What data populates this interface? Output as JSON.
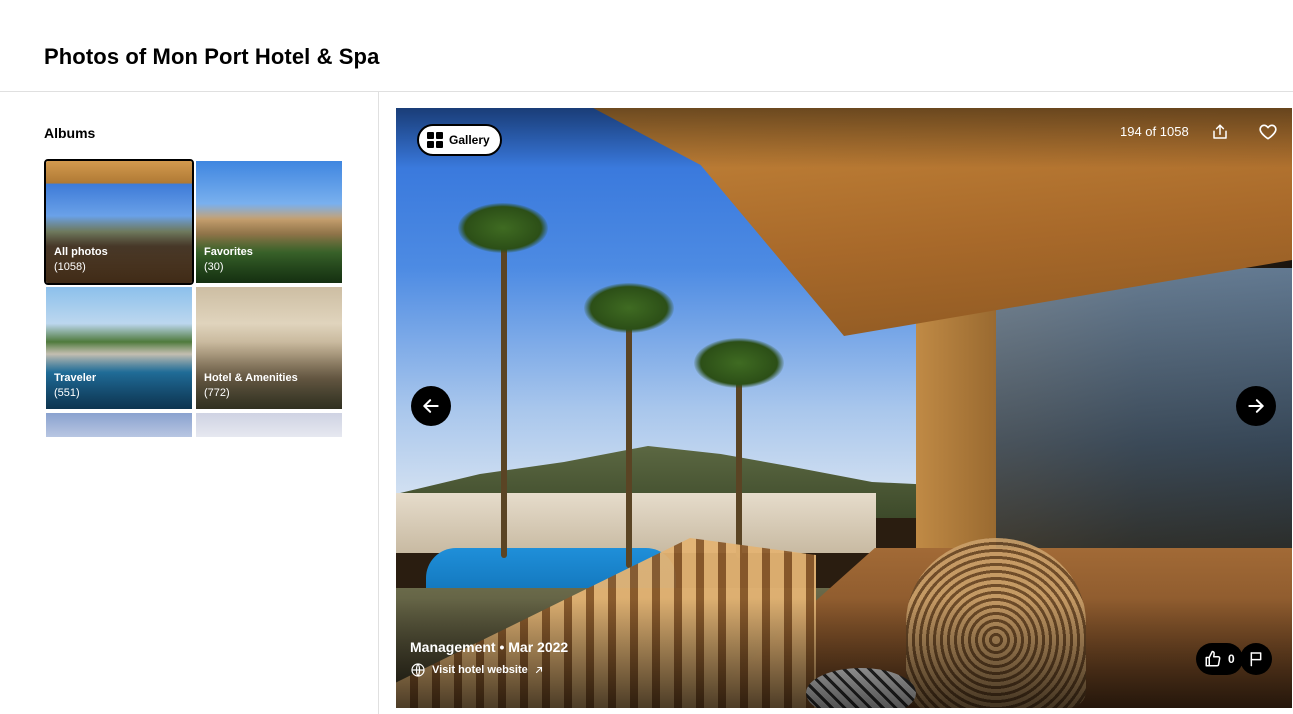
{
  "header": {
    "title": "Photos of Mon Port Hotel & Spa"
  },
  "sidebar": {
    "heading": "Albums",
    "albums": [
      {
        "label": "All photos",
        "count": "(1058)"
      },
      {
        "label": "Favorites",
        "count": "(30)"
      },
      {
        "label": "Traveler",
        "count": "(551)"
      },
      {
        "label": "Hotel & Amenities",
        "count": "(772)"
      }
    ]
  },
  "viewer": {
    "gallery_label": "Gallery",
    "counter": "194 of 1058",
    "caption": "Management • Mar 2022",
    "visit_link": "Visit hotel website",
    "likes": "0"
  },
  "icons": {
    "gallery": "grid-icon",
    "share": "share-icon",
    "favorite": "heart-icon",
    "prev": "arrow-left-icon",
    "next": "arrow-right-icon",
    "website": "globe-icon",
    "external": "external-link-icon",
    "like": "thumbs-up-icon",
    "report": "flag-icon"
  },
  "colors": {
    "accent": "#000000",
    "background": "#ffffff",
    "divider": "#e0e0e0"
  }
}
